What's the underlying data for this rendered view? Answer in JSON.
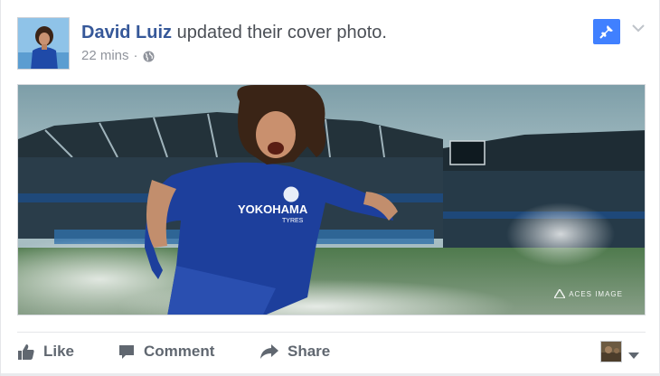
{
  "post": {
    "author": "David Luiz",
    "action_text": "updated their cover photo.",
    "timestamp": "22 mins",
    "separator": "·",
    "privacy_icon": "globe-icon",
    "pin_icon": "pin-icon",
    "options_icon": "chevron-down-icon"
  },
  "cover": {
    "sponsor_text": "YOKOHAMA",
    "sponsor_sub": "TYRES",
    "watermark": "ACES IMAGE"
  },
  "actions": {
    "like_label": "Like",
    "comment_label": "Comment",
    "share_label": "Share"
  },
  "colors": {
    "brand_blue": "#365899",
    "pin_blue": "#4080ff",
    "jersey_blue": "#1d3f9c",
    "muted": "#90949c"
  }
}
